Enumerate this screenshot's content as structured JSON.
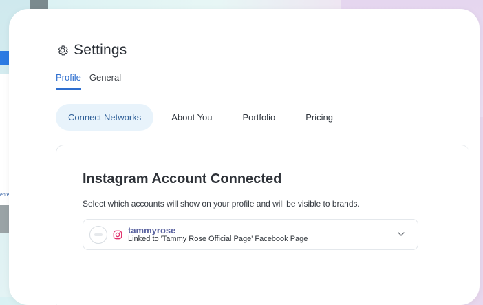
{
  "background": {
    "left_fragment_text": "ente"
  },
  "header": {
    "title": "Settings",
    "tabs": [
      {
        "label": "Profile",
        "active": true
      },
      {
        "label": "General",
        "active": false
      }
    ]
  },
  "subtabs": [
    {
      "label": "Connect Networks",
      "active": true
    },
    {
      "label": "About You",
      "active": false
    },
    {
      "label": "Portfolio",
      "active": false
    },
    {
      "label": "Pricing",
      "active": false
    }
  ],
  "panel": {
    "title": "Instagram Account Connected",
    "subtitle": "Select which accounts will show on your profile and will be visible to brands.",
    "account": {
      "username": "tammyrose",
      "linked_text": "Linked to 'Tammy Rose Official Page' Facebook Page"
    }
  },
  "colors": {
    "accent": "#2f6fcf",
    "subtab_active_bg": "#e8f3fb",
    "instagram": "#e1306c"
  },
  "icons": {
    "title": "gear-icon",
    "account_network": "instagram-icon",
    "dropdown": "chevron-down-icon"
  }
}
